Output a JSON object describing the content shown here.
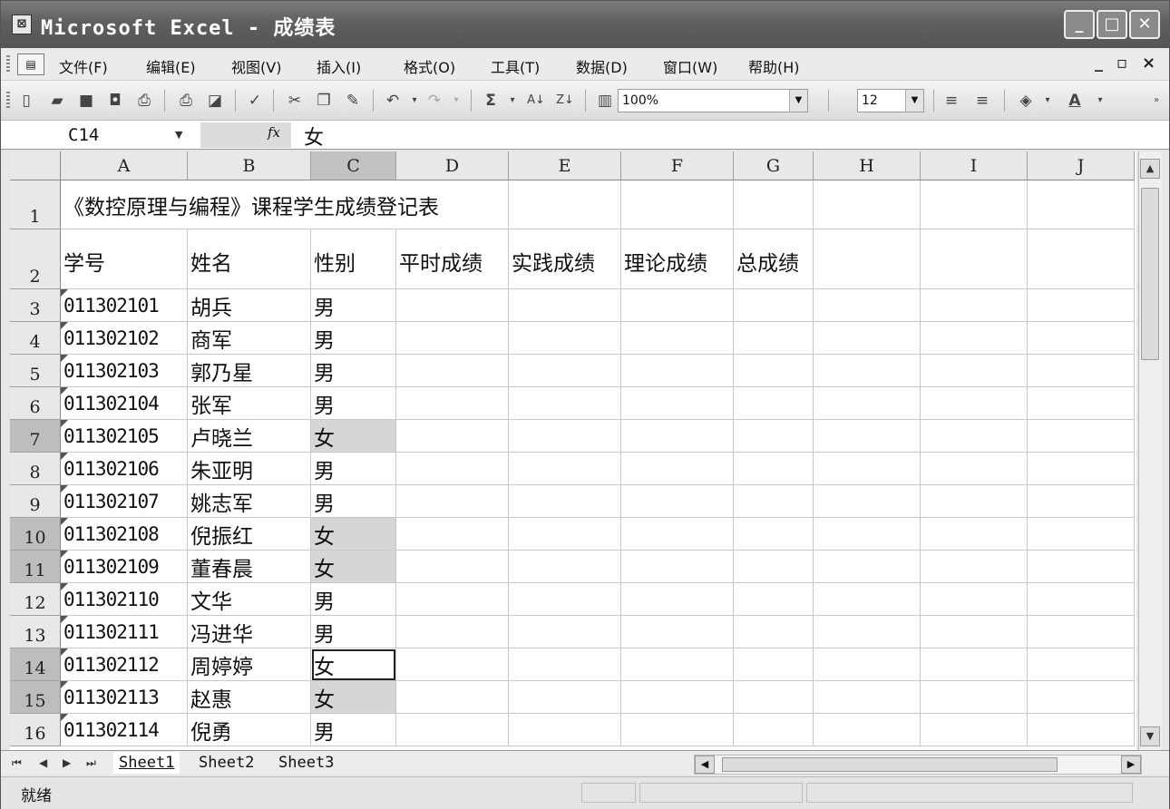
{
  "window": {
    "title": "Microsoft Excel - 成绩表"
  },
  "menu": {
    "items": [
      "文件(F)",
      "编辑(E)",
      "视图(V)",
      "插入(I)",
      "格式(O)",
      "工具(T)",
      "数据(D)",
      "窗口(W)",
      "帮助(H)"
    ]
  },
  "toolbar": {
    "zoom": "100%",
    "font_size": "12"
  },
  "formula_bar": {
    "name_box": "C14",
    "fx": "fx",
    "value": "女"
  },
  "grid": {
    "columns": [
      "A",
      "B",
      "C",
      "D",
      "E",
      "F",
      "G",
      "H",
      "I",
      "J"
    ],
    "selected_column": "C",
    "rows": [
      {
        "num": "1",
        "cells": [
          "《数控原理与编程》课程学生成绩登记表",
          "",
          "",
          "",
          "",
          "",
          ""
        ]
      },
      {
        "num": "2",
        "cells": [
          "学号",
          "姓名",
          "性别",
          "平时成绩",
          "实践成绩",
          "理论成绩",
          "总成绩"
        ]
      },
      {
        "num": "3",
        "cells": [
          "011302101",
          "胡兵",
          "男"
        ]
      },
      {
        "num": "4",
        "cells": [
          "011302102",
          "商军",
          "男"
        ]
      },
      {
        "num": "5",
        "cells": [
          "011302103",
          "郭乃星",
          "男"
        ]
      },
      {
        "num": "6",
        "cells": [
          "011302104",
          "张军",
          "男"
        ]
      },
      {
        "num": "7",
        "cells": [
          "011302105",
          "卢晓兰",
          "女"
        ]
      },
      {
        "num": "8",
        "cells": [
          "011302106",
          "朱亚明",
          "男"
        ]
      },
      {
        "num": "9",
        "cells": [
          "011302107",
          "姚志军",
          "男"
        ]
      },
      {
        "num": "10",
        "cells": [
          "011302108",
          "倪振红",
          "女"
        ]
      },
      {
        "num": "11",
        "cells": [
          "011302109",
          "董春晨",
          "女"
        ]
      },
      {
        "num": "12",
        "cells": [
          "011302110",
          "文华",
          "男"
        ]
      },
      {
        "num": "13",
        "cells": [
          "011302111",
          "冯进华",
          "男"
        ]
      },
      {
        "num": "14",
        "cells": [
          "011302112",
          "周婷婷",
          "女"
        ]
      },
      {
        "num": "15",
        "cells": [
          "011302113",
          "赵惠",
          "女"
        ]
      },
      {
        "num": "16",
        "cells": [
          "011302114",
          "倪勇",
          "男"
        ]
      }
    ],
    "highlighted_rows": [
      "7",
      "10",
      "11",
      "14",
      "15"
    ],
    "active_cell": "C14"
  },
  "sheets": [
    "Sheet1",
    "Sheet2",
    "Sheet3"
  ],
  "active_sheet": "Sheet1",
  "status": {
    "text": "就绪"
  }
}
